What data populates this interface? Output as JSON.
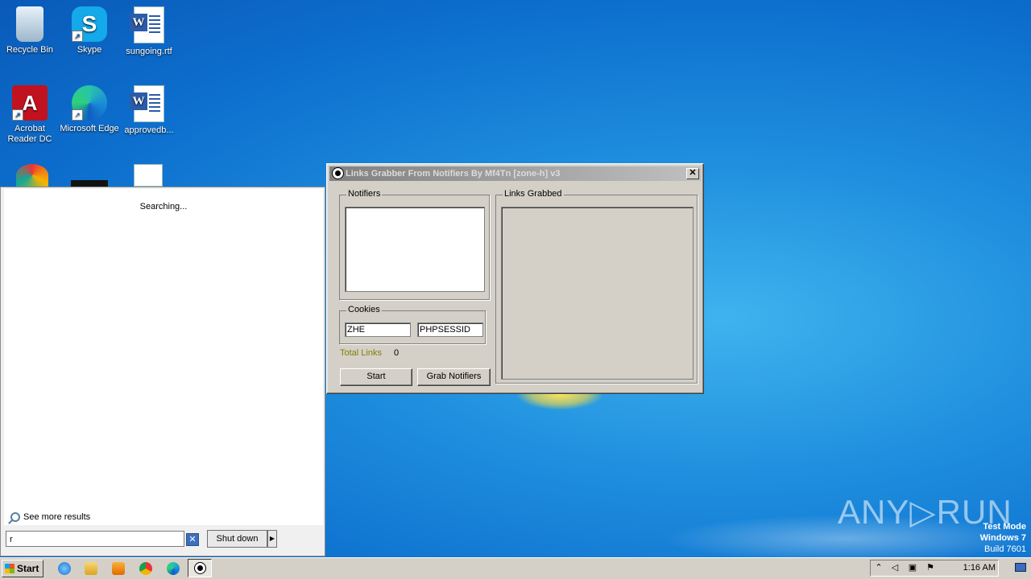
{
  "desktop": {
    "icons": [
      {
        "label": "Recycle Bin",
        "icon": "recycle-bin-icon"
      },
      {
        "label": "Skype",
        "icon": "skype-icon"
      },
      {
        "label": "sungoing.rtf",
        "icon": "word-document-icon"
      },
      {
        "label": "Acrobat Reader DC",
        "icon": "acrobat-icon"
      },
      {
        "label": "Microsoft Edge",
        "icon": "edge-icon"
      },
      {
        "label": "approvedb...",
        "icon": "word-document-icon"
      }
    ]
  },
  "start_menu": {
    "status": "Searching...",
    "see_more": "See more results",
    "search_value": "r",
    "shutdown_label": "Shut down"
  },
  "app_window": {
    "title": "Links Grabber From Notifiers By Mf4Tn [zone-h] v3",
    "notifiers_legend": "Notifiers",
    "links_legend": "Links Grabbed",
    "cookies_legend": "Cookies",
    "cookie_zhe": "ZHE",
    "cookie_phpsessid": "PHPSESSID",
    "total_links_label": "Total Links",
    "total_links_value": "0",
    "start_button": "Start",
    "grab_button": "Grab Notifiers"
  },
  "watermark": {
    "brand": "ANY▷RUN",
    "test_mode": "Test Mode",
    "os": "Windows 7",
    "build": "Build 7601"
  },
  "taskbar": {
    "start_label": "Start",
    "clock": "1:16 AM"
  },
  "colors": {
    "desktop_blue": "#1f8fde",
    "window_face": "#d4d0c8",
    "total_links_label": "#808000"
  }
}
